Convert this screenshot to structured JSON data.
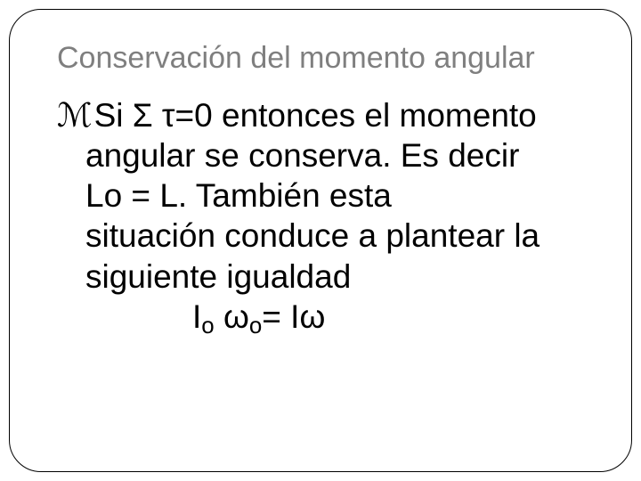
{
  "title": "Conservación del momento angular",
  "bullet": {
    "glyph": "ℳ",
    "line1": "Si Σ τ=0 entonces el momento",
    "line2": "angular se conserva.  Es decir",
    "line3": " Lo = L.  También esta",
    "line4": "situación conduce a plantear la",
    "line5": "siguiente igualdad",
    "eq_I1": "I",
    "eq_sub_o1": "o",
    "eq_sp1": " ",
    "eq_w1": "ω",
    "eq_sub_o2": "o",
    "eq_mid": "= I",
    "eq_w2": "ω"
  }
}
